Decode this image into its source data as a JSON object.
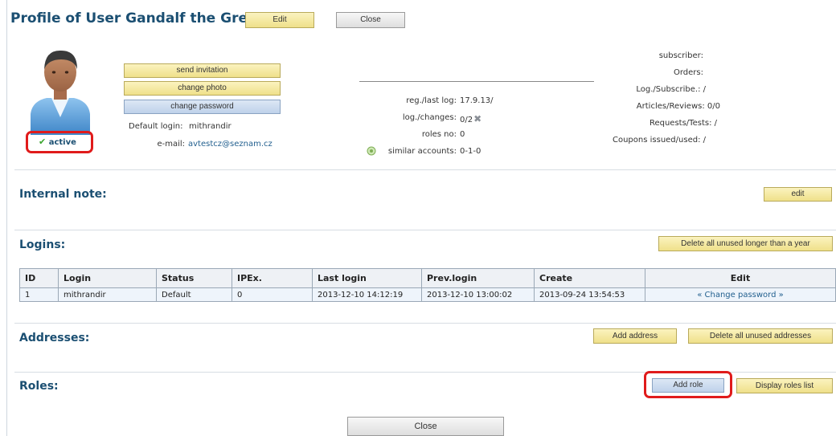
{
  "header": {
    "title": "Profile of User Gandalf the Grey",
    "edit_label": "Edit",
    "close_label": "Close"
  },
  "profile": {
    "status": "active",
    "buttons": {
      "send_invitation": "send invitation",
      "change_photo": "change photo",
      "change_password": "change password"
    },
    "default_login_label": "Default login:",
    "default_login_value": "mithrandir",
    "email_label": "e-mail:",
    "email_value": "avtestcz@seznam.cz"
  },
  "stats_middle": {
    "reg_label": "reg./last log:",
    "reg_value": "17.9.13/",
    "log_changes_label": "log./changes:",
    "log_changes_value": "0/2",
    "roles_no_label": "roles no:",
    "roles_no_value": "0",
    "similar_label": "similar accounts:",
    "similar_value": "0-1-0"
  },
  "stats_right": {
    "subscriber": "subscriber:",
    "orders": "Orders:",
    "log_subscribe": "Log./Subscribe.: /",
    "articles_reviews": "Articles/Reviews: 0/0",
    "requests_tests": "Requests/Tests: /",
    "coupons": "Coupons issued/used: /"
  },
  "internal_note": {
    "title": "Internal note:",
    "edit_label": "edit"
  },
  "logins": {
    "title": "Logins:",
    "delete_unused_label": "Delete all unused longer than a year",
    "columns": [
      "ID",
      "Login",
      "Status",
      "IPEx.",
      "Last login",
      "Prev.login",
      "Create",
      "Edit"
    ],
    "rows": [
      {
        "id": "1",
        "login": "mithrandir",
        "status": "Default",
        "ipex": "0",
        "last_login": "2013-12-10 14:12:19",
        "prev_login": "2013-12-10 13:00:02",
        "create": "2013-09-24 13:54:53",
        "edit": "« Change password »"
      }
    ]
  },
  "addresses": {
    "title": "Addresses:",
    "add_label": "Add address",
    "delete_unused_label": "Delete all unused addresses"
  },
  "roles": {
    "title": "Roles:",
    "add_label": "Add role",
    "display_list_label": "Display roles list"
  },
  "footer": {
    "close_label": "Close"
  },
  "colors": {
    "title": "#1b4f72",
    "highlight": "#e01b1b",
    "button_yellow": "#efe08a",
    "button_blue": "#bfd2ea",
    "check_green": "#3aa52e"
  },
  "icons": [
    "user-avatar-icon",
    "checkmark-icon",
    "tools-icon",
    "similar-accounts-icon"
  ]
}
